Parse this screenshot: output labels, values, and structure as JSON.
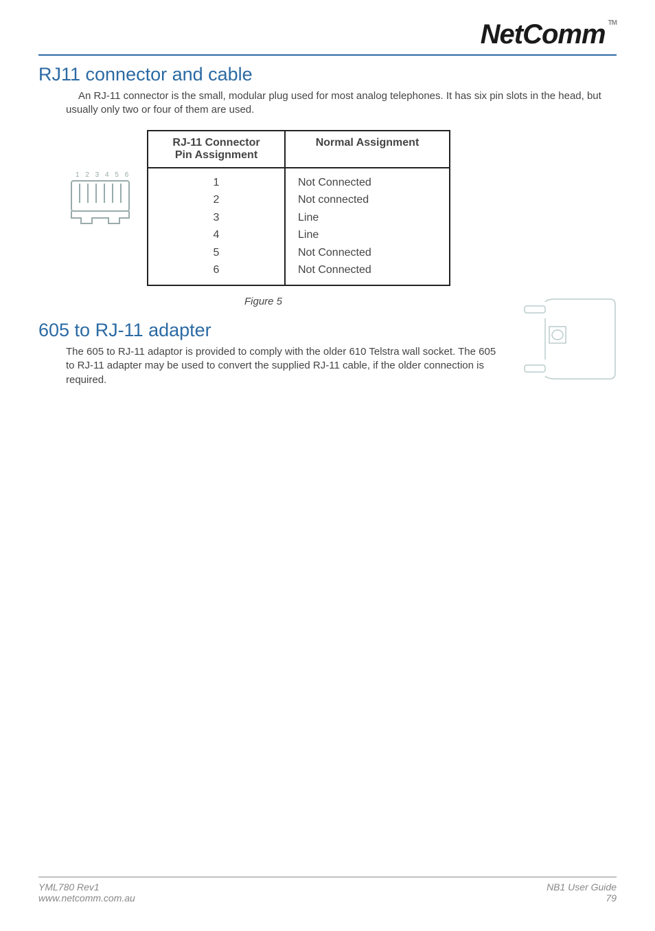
{
  "header": {
    "brand": "NetComm",
    "tm": "TM"
  },
  "section1": {
    "heading": "RJ11 connector and cable",
    "paragraph": " An RJ-11 connector is the small, modular plug used for most analog telephones. It has six pin slots in the head, but usually only two or four of them are used."
  },
  "rj11_diagram": {
    "pin_labels": "1 2 3 4 5 6"
  },
  "pin_table": {
    "header_left": "RJ-11 Connector Pin Assignment",
    "header_left_l1": "RJ-11 Connector",
    "header_left_l2": "Pin Assignment",
    "header_right": "Normal Assignment",
    "rows": [
      {
        "pin": "1",
        "assign": "Not Connected"
      },
      {
        "pin": "2",
        "assign": "Not connected"
      },
      {
        "pin": "3",
        "assign": "Line"
      },
      {
        "pin": "4",
        "assign": "Line"
      },
      {
        "pin": "5",
        "assign": "Not Connected"
      },
      {
        "pin": "6",
        "assign": "Not Connected"
      }
    ]
  },
  "figure_caption": "Figure 5",
  "section2": {
    "heading": "605 to RJ-11 adapter",
    "paragraph": "The 605 to RJ-11 adaptor is provided to comply with the older 610 Telstra wall socket.  The 605 to RJ-11 adapter may be used to convert the supplied RJ-11 cable, if the older connection is required."
  },
  "footer": {
    "left_line1": "YML780 Rev1",
    "left_line2": "www.netcomm.com.au",
    "right_line1": "NB1 User Guide",
    "right_line2": "79"
  }
}
